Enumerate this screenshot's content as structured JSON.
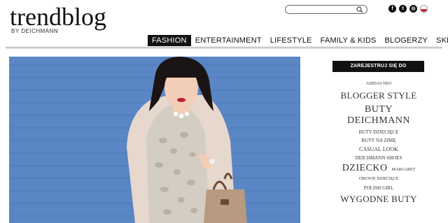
{
  "header": {
    "logo_title": "trendblog",
    "logo_sub": "BY DEICHMANN"
  },
  "search": {
    "placeholder": "",
    "value": ""
  },
  "social": {
    "icons": [
      "facebook-icon",
      "twitter-icon",
      "instagram-icon",
      "flag-poland-icon"
    ],
    "facebook_glyph": "f",
    "twitter_glyph": "t",
    "instagram_glyph": "◎"
  },
  "nav": {
    "items": [
      "FASHION",
      "ENTERTAINMENT",
      "LIFESTYLE",
      "FAMILY & KIDS",
      "BLOGERZY",
      "SKLEP"
    ],
    "active": "FASHION"
  },
  "sidebar": {
    "newsletter_label": "ZAREJESTRUJ SIĘ DO NEWSLETTERA",
    "tags": [
      "ADIDAS NEO",
      "BLOGGER STYLE",
      "BUTY DEICHMANN",
      "BUTY DZIECIĘCE",
      "BUTY NA ZIMĘ",
      "CASUAL LOOK",
      "DEICHMANN SHOES",
      "DZIECKO",
      "MARGARET",
      "OBUWIE DZIECIĘCE",
      "POLISH GIRL",
      "WYGODNE BUTY"
    ]
  },
  "colors": {
    "nav_active_bg": "#111111",
    "hero_bg": "#5b86c5",
    "flag_red": "#d4213d"
  }
}
